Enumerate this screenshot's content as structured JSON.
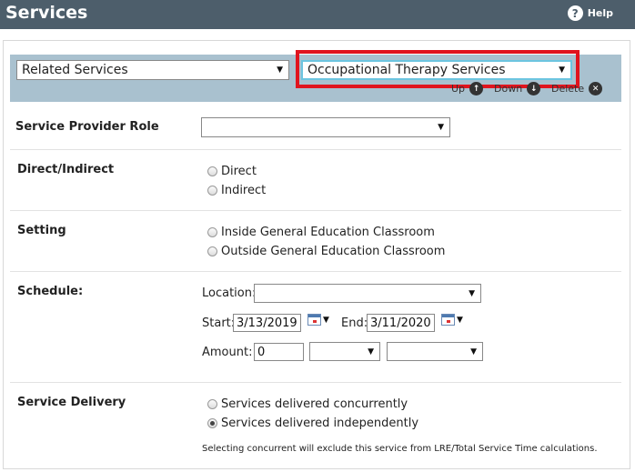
{
  "header": {
    "title": "Services",
    "help_label": "Help",
    "help_icon": "question-circle-icon"
  },
  "top_controls": {
    "service_type": "Related Services",
    "service_name": "Occupational Therapy Services",
    "up_label": "Up",
    "down_label": "Down",
    "delete_label": "Delete",
    "highlight_color": "#e0141e"
  },
  "fields": {
    "provider_role_label": "Service Provider Role",
    "provider_role_value": "",
    "direct_indirect_label": "Direct/Indirect",
    "direct_option": "Direct",
    "indirect_option": "Indirect",
    "setting_label": "Setting",
    "inside_option": "Inside General Education Classroom",
    "outside_option": "Outside General Education Classroom",
    "schedule_label": "Schedule:",
    "location_label": "Location:",
    "location_value": "",
    "start_label": "Start:",
    "start_value": "3/13/2019",
    "end_label": "End:",
    "end_value": "3/11/2020",
    "amount_label": "Amount:",
    "amount_value": "0",
    "amount_unit": "",
    "amount_frequency": "",
    "delivery_label": "Service Delivery",
    "concurrent_option": "Services delivered concurrently",
    "independent_option": "Services delivered independently",
    "selected_delivery": "independently",
    "delivery_note": "Selecting concurrent will exclude this service from LRE/Total Service Time calculations."
  }
}
